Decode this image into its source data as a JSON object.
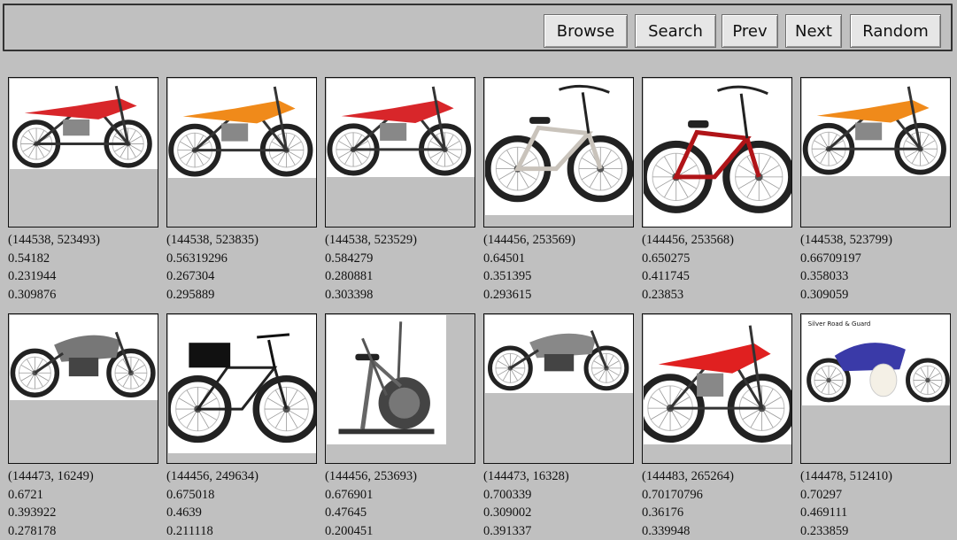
{
  "toolbar": {
    "buttons": [
      {
        "id": "browse",
        "label": "Browse"
      },
      {
        "id": "search",
        "label": "Search"
      },
      {
        "id": "prev",
        "label": "Prev"
      },
      {
        "id": "next",
        "label": "Next"
      },
      {
        "id": "random",
        "label": "Random"
      }
    ]
  },
  "results": [
    {
      "id": "(144538, 523493)",
      "v1": "0.54182",
      "v2": "0.231944",
      "v3": "0.309876",
      "kind": "dirtbike",
      "color": "#d8262a"
    },
    {
      "id": "(144538, 523835)",
      "v1": "0.56319296",
      "v2": "0.267304",
      "v3": "0.295889",
      "kind": "dirtbike",
      "color": "#f08a1a"
    },
    {
      "id": "(144538, 523529)",
      "v1": "0.584279",
      "v2": "0.280881",
      "v3": "0.303398",
      "kind": "dirtbike",
      "color": "#d8262a"
    },
    {
      "id": "(144456, 253569)",
      "v1": "0.64501",
      "v2": "0.351395",
      "v3": "0.293615",
      "kind": "bmx",
      "color": "#c9c3bb"
    },
    {
      "id": "(144456, 253568)",
      "v1": "0.650275",
      "v2": "0.411745",
      "v3": "0.23853",
      "kind": "bmx",
      "color": "#b01418"
    },
    {
      "id": "(144538, 523799)",
      "v1": "0.66709197",
      "v2": "0.358033",
      "v3": "0.309059",
      "kind": "dirtbike",
      "color": "#f08a1a"
    },
    {
      "id": "(144473, 16249)",
      "v1": "0.6721",
      "v2": "0.393922",
      "v3": "0.278178",
      "kind": "motorcycle",
      "color": "#777777"
    },
    {
      "id": "(144456, 249634)",
      "v1": "0.675018",
      "v2": "0.4639",
      "v3": "0.211118",
      "kind": "bicycle",
      "color": "#222222"
    },
    {
      "id": "(144456, 253693)",
      "v1": "0.676901",
      "v2": "0.47645",
      "v3": "0.200451",
      "kind": "exercise",
      "color": "#666666"
    },
    {
      "id": "(144473, 16328)",
      "v1": "0.700339",
      "v2": "0.309002",
      "v3": "0.391337",
      "kind": "motorcycle",
      "color": "#888888"
    },
    {
      "id": "(144483, 265264)",
      "v1": "0.70170796",
      "v2": "0.36176",
      "v3": "0.339948",
      "kind": "dirtbike",
      "color": "#e02020"
    },
    {
      "id": "(144478, 512410)",
      "v1": "0.70297",
      "v2": "0.469111",
      "v3": "0.233859",
      "kind": "cruiser",
      "color": "#3a3aa8"
    }
  ]
}
